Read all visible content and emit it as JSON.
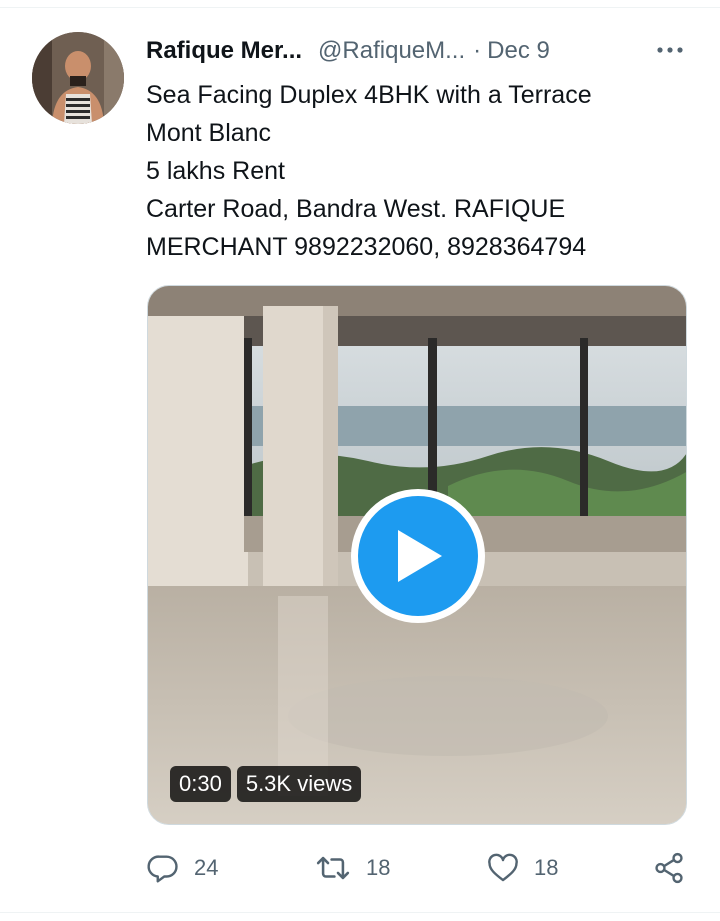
{
  "tweet": {
    "author_name": "Rafique Mer...",
    "author_handle": "@RafiqueM...",
    "separator": "·",
    "date": "Dec 9",
    "text_lines": [
      "Sea Facing Duplex 4BHK with a Terrace",
      "Mont Blanc",
      "5 lakhs Rent",
      "Carter Road, Bandra West. RAFIQUE",
      "MERCHANT 9892232060, 8928364794"
    ],
    "video": {
      "duration": "0:30",
      "views": "5.3K views"
    },
    "actions": {
      "replies": "24",
      "retweets": "18",
      "likes": "18"
    }
  },
  "icons": {
    "more": "more-horizontal-icon",
    "reply": "reply-icon",
    "retweet": "retweet-icon",
    "like": "heart-icon",
    "share": "share-icon",
    "play": "play-icon"
  },
  "colors": {
    "accent": "#1d9bf0",
    "text": "#0f1419",
    "secondary": "#536471"
  }
}
